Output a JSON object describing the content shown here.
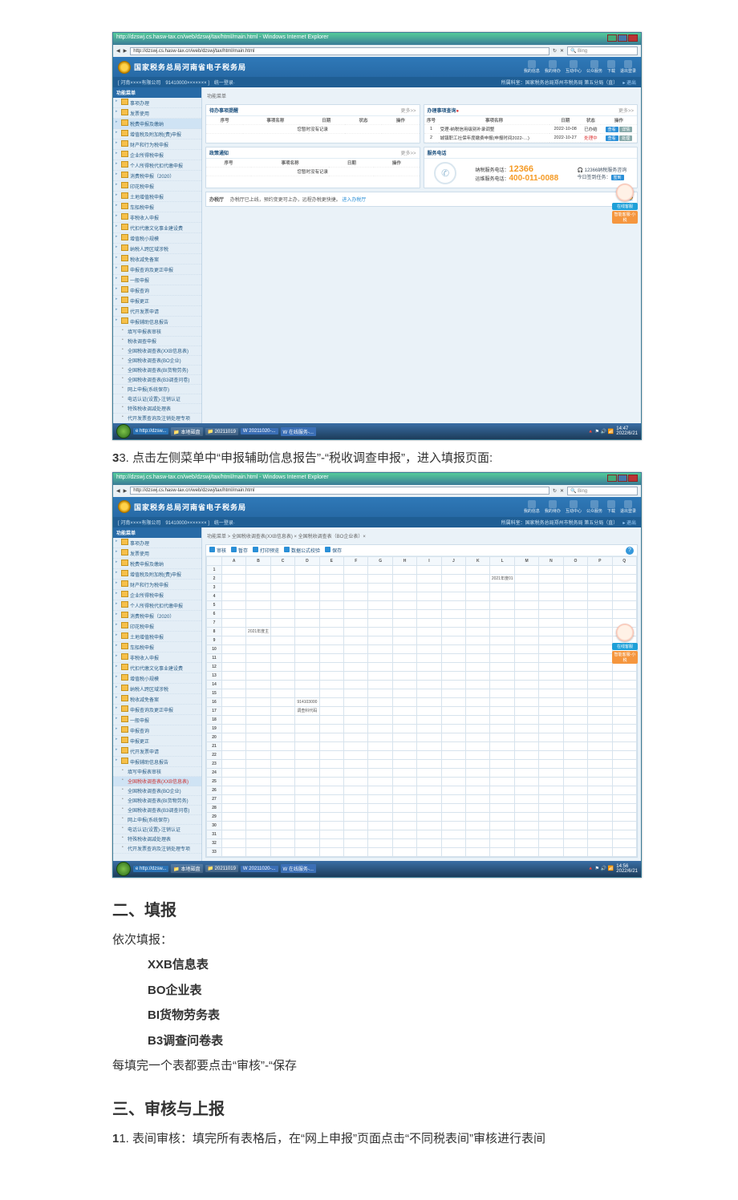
{
  "browser": {
    "wintitle": "http://dzswj.cs.hasw-tax.cn/web/dzswj/tax/html/main.html - Windows Internet Explorer",
    "url": "http://dzswj.cs.hasw-tax.cn/web/dzswj/tax/html/main.html",
    "search_placeholder": "Bing"
  },
  "site": {
    "name": "国家税务总局河南省电子税务局",
    "header_icons": [
      "我的信息",
      "我的待办",
      "互动中心",
      "公众服务",
      "下载",
      "退出登录"
    ],
    "company_info": "[ 河南××××有限公司　91410000××××××× ]　统一登录·",
    "top_right": "所属科室：国家税务总局郑州市税务局 第五分局（直）",
    "crumb": "功能菜单",
    "sidebar": {
      "cat": "功能菜单",
      "items": [
        "事项办理",
        "发票使用",
        "税费申报及缴纳",
        "增值税及附加税(费)申报",
        "财产和行为税申报",
        "企业所得税申报",
        "个人所得税代扣代缴申报",
        "消费税申报（2020）",
        "印花税申报",
        "土地增值税申报",
        "车船税申报",
        "非税收入申报",
        "代扣代缴文化事业建设费",
        "增值税小规模",
        "纳税人跨区域涉税",
        "税收减免备案",
        "申报查询及更正申报",
        "一般申报",
        "申报查询",
        "申报更正",
        "代开发票申请",
        "申报辅助信息报告",
        "填写申报表审核",
        "税收调查申报",
        "全国税收调查表(XXB信息表)",
        "全国税收调查表(BO企业)",
        "全国税收调查表(BI货物劳务)",
        "全国税收调查表(B3调查问卷)",
        "网上申报(系统保存)",
        "电话认证(设置)-注销认证",
        "特殊税收调减处理表",
        "代开发票查询及注销处理专项"
      ]
    },
    "panel1": {
      "title": "待办事项提醒",
      "more": "更多>>",
      "th": [
        "序号",
        "事项名称",
        "日期",
        "状态",
        "操作"
      ],
      "empty": "您暂时没有记录"
    },
    "panel2": {
      "title": "办理事项查询",
      "more": "更多>>",
      "th": [
        "序号",
        "事项名称",
        "日期",
        "状态",
        "操作"
      ],
      "rows": [
        {
          "n": "1",
          "name": "受理-纳税信用级别补录调整",
          "date": "2022-10-08",
          "state": "已办结",
          "op1": "查看",
          "op2": "详情"
        },
        {
          "n": "2",
          "name": "城镇职工社保年度缴费申报(申报时间2022-…)",
          "date": "2022-10-27",
          "state": "处理中",
          "op1": "查看",
          "op2": "处理"
        }
      ]
    },
    "panel3": {
      "title": "政策通知",
      "more": "更多>>",
      "th": [
        "序号",
        "事项名称",
        "日期",
        "操作"
      ],
      "empty": "您暂时没有记录"
    },
    "panel_phone": {
      "title": "服务电话",
      "l1": "纳税服务电话：",
      "n1": "12366",
      "l2": "运维服务电话：",
      "n2": "400-011-0088",
      "r1": "12366纳税服务咨询",
      "r2": "今日签到任务：",
      "btn": "签到"
    },
    "office": {
      "title": "办税厅",
      "text": "办税厅已上线，预约变更可上办，远程办税更快捷。",
      "link": "进入办税厅"
    },
    "helper": {
      "a": "在线客服",
      "b": "智能客服-小税"
    }
  },
  "shot2": {
    "crumb": "功能菜单 > 全国税收调查表(XXB信息表) × 全国税收调查表（BO企业表）×",
    "tabs": [
      "审核",
      "暂存",
      "打印预览",
      "数据公式校验",
      "保存"
    ],
    "cols": [
      "A",
      "B",
      "C",
      "D",
      "E",
      "F",
      "G",
      "H",
      "I",
      "J",
      "K",
      "L",
      "M",
      "N",
      "O",
      "P",
      "Q"
    ],
    "row2_L": "2021年度01",
    "row8_B": "2021年度主",
    "row16_D": "914103000",
    "row17_D": "调查科代码"
  },
  "taskbar": {
    "items": [
      "http://dzsw...",
      "本地磁盘",
      "20211019",
      "20211020-...",
      "在线服务-..."
    ],
    "clock_time": "14:47",
    "clock_date": "2022/6/21",
    "clock_time2": "14:56",
    "clock_date2": "2022/6/21"
  },
  "doc": {
    "step3": "3. 点击左侧菜单中“申报辅助信息报告”-“税收调查申报”，进入填报页面:",
    "h2a": "二、填报",
    "p_intro": "依次填报：",
    "list": [
      "XXB信息表",
      "BO企业表",
      "BI货物劳务表",
      "B3调查问卷表"
    ],
    "p_after": "每填完一个表都要点击“审核”-“保存",
    "h2b": "三、审核与上报",
    "p_b1": "1. 表间审核：填完所有表格后，在“网上申报”页面点击“不同税表间”审核进行表间"
  }
}
